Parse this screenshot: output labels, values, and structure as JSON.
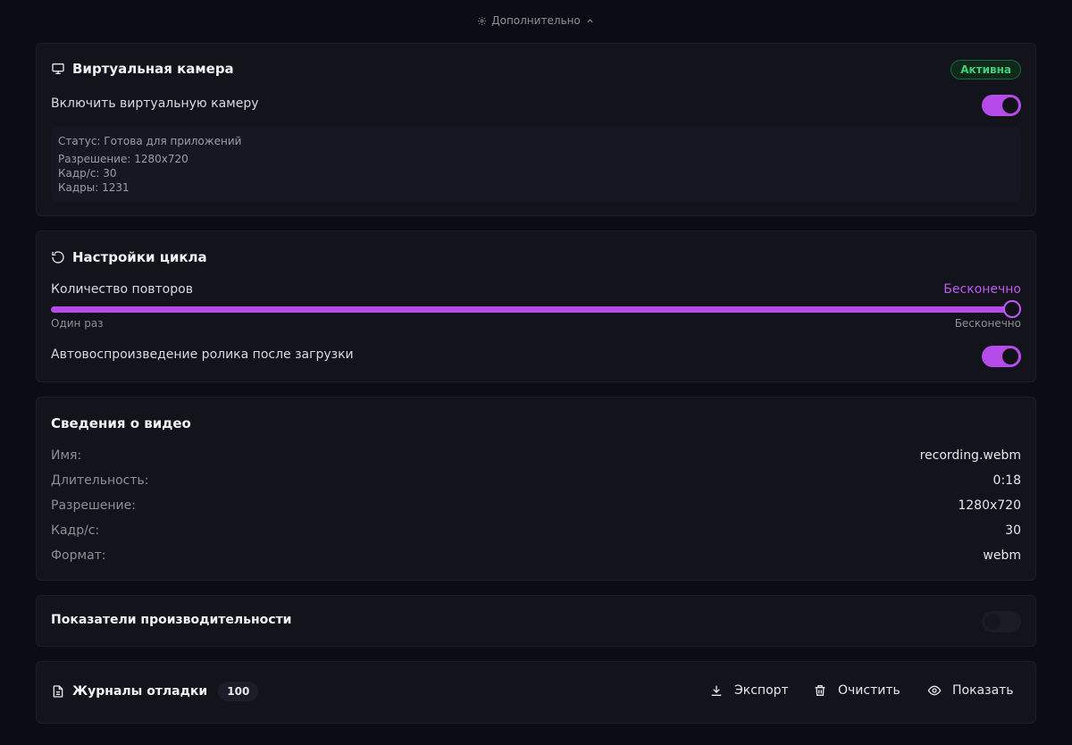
{
  "advanced_toggle": {
    "label": "Дополнительно"
  },
  "virtual_camera": {
    "title": "Виртуальная камера",
    "badge": "Активна",
    "enable_label": "Включить виртуальную камеру",
    "enabled": true,
    "status_line": "Статус: Готова для приложений",
    "resolution_line": "Разрешение: 1280x720",
    "fps_line": "Кадр/с: 30",
    "frames_line": "Кадры: 1231"
  },
  "loop_settings": {
    "title": "Настройки цикла",
    "repeat_label": "Количество повторов",
    "repeat_value": "Бесконечно",
    "slider_level": 1.0,
    "slider_min_label": "Один раз",
    "slider_max_label": "Бесконечно",
    "autoplay_label": "Автовоспроизведение ролика после загрузки",
    "autoplay_enabled": true
  },
  "video_info": {
    "title": "Сведения о видео",
    "rows": [
      {
        "key": "Имя:",
        "value": "recording.webm"
      },
      {
        "key": "Длительность:",
        "value": "0:18"
      },
      {
        "key": "Разрешение:",
        "value": "1280x720"
      },
      {
        "key": "Кадр/с:",
        "value": "30"
      },
      {
        "key": "Формат:",
        "value": "webm"
      }
    ]
  },
  "performance": {
    "title": "Показатели производительности",
    "enabled": false
  },
  "debug_logs": {
    "title": "Журналы отладки",
    "count": "100",
    "export_label": "Экспорт",
    "clear_label": "Очистить",
    "show_label": "Показать"
  },
  "colors": {
    "accent": "#b54be8",
    "active_badge": "#3ed07a",
    "background": "#0c0d14",
    "card": "#12131b"
  },
  "icons": [
    "gear-icon",
    "chevron-up-icon",
    "monitor-icon",
    "refresh-icon",
    "file-icon",
    "download-icon",
    "trash-icon",
    "eye-icon"
  ]
}
